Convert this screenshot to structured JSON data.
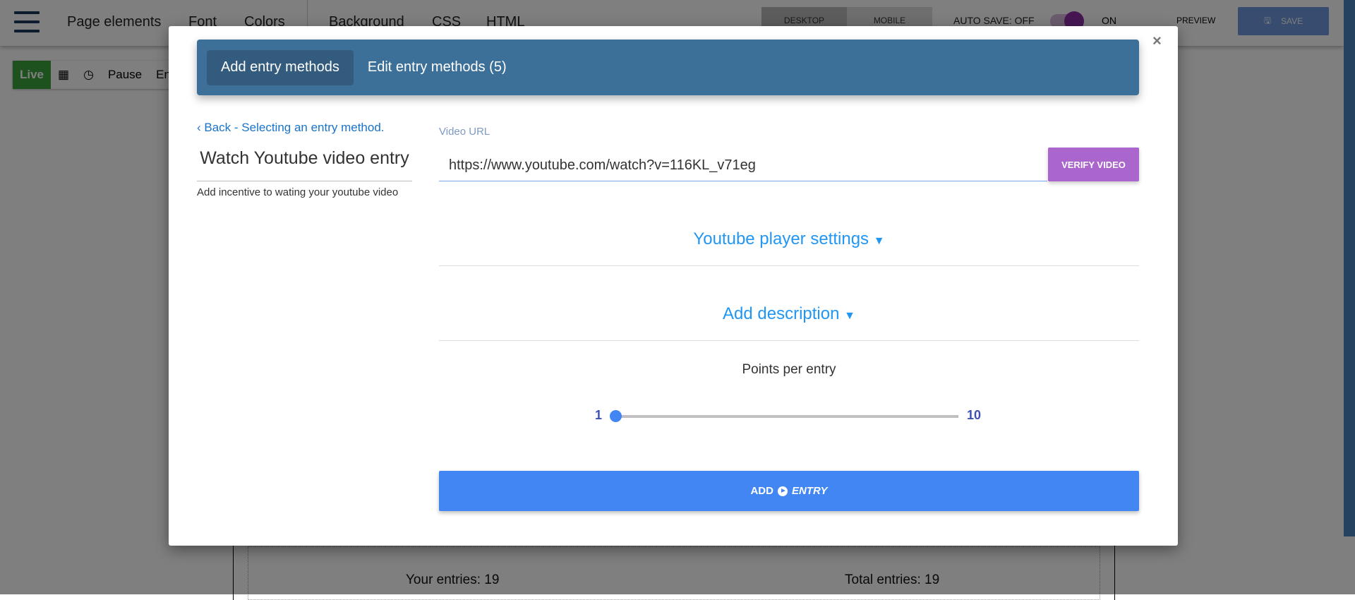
{
  "topbar": {
    "nav": [
      "Page elements",
      "Font",
      "Colors",
      "Background",
      "CSS",
      "HTML"
    ],
    "device": [
      "DESKTOP",
      "MOBILE"
    ],
    "auto_save": "AUTO SAVE: OFF",
    "on": "ON",
    "preview": "PREVIEW",
    "save": "SAVE"
  },
  "toolbar": {
    "live": "Live",
    "pause": "Pause",
    "end": "En"
  },
  "page": {
    "your_entries": "Your entries: 19",
    "total_entries": "Total entries: 19"
  },
  "modal": {
    "close": "×",
    "tabs": [
      "Add entry methods",
      "Edit entry methods (5)"
    ],
    "back": "Back - Selecting an entry method.",
    "title": "Watch Youtube video entry",
    "subtitle": "Add incentive to wating your youtube video",
    "video_url_label": "Video URL",
    "video_url_value": "https://www.youtube.com/watch?v=116KL_v71eg",
    "verify": "VERIFY VIDEO",
    "player_settings": "Youtube player settings",
    "add_description": "Add description",
    "points_label": "Points per entry",
    "slider": {
      "min": "1",
      "max": "10",
      "value": 1
    },
    "add_button": {
      "add": "ADD",
      "entry": "ENTRY"
    }
  },
  "colors": {
    "header": "#3d7099",
    "verify": "#aa66cc",
    "primary": "#4286f4",
    "link": "#2196f3"
  }
}
